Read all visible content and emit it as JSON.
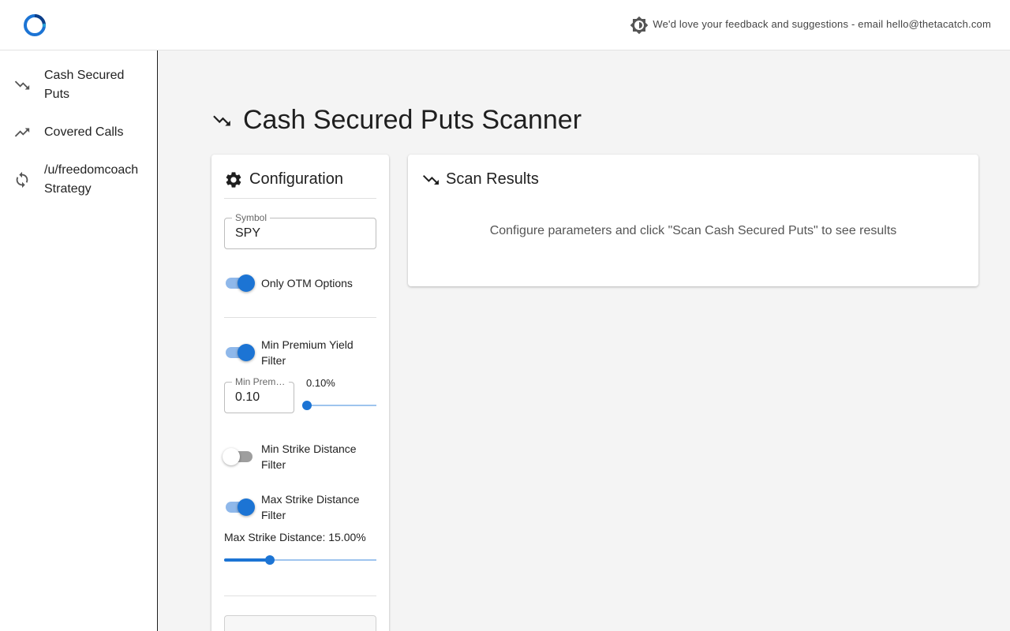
{
  "header": {
    "logo_icon": "ring-logo-icon",
    "theme_icon": "brightness-icon",
    "feedback_text": "We'd love your feedback and suggestions - email hello@thetacatch.com"
  },
  "sidebar": {
    "items": [
      {
        "icon": "trending-down-icon",
        "label": "Cash Secured Puts"
      },
      {
        "icon": "trending-up-icon",
        "label": "Covered Calls"
      },
      {
        "icon": "sync-icon",
        "label": "/u/freedomcoach Strategy"
      }
    ]
  },
  "page": {
    "title": "Cash Secured Puts Scanner",
    "title_icon": "trending-down-icon"
  },
  "config": {
    "title": "Configuration",
    "icon": "gear-icon",
    "symbol": {
      "label": "Symbol",
      "value": "SPY"
    },
    "otm": {
      "label": "Only OTM Options",
      "on": true
    },
    "min_premium": {
      "label": "Min Premium Yield Filter",
      "on": true,
      "input_label": "Min Premium Yield (%)",
      "input_value": "0.10",
      "slider_text": "0.10%",
      "slider_fraction": 0.0
    },
    "min_strike": {
      "label": "Min Strike Distance Filter",
      "on": false
    },
    "max_strike": {
      "label": "Max Strike Distance Filter",
      "on": true,
      "value_text": "Max Strike Distance: 15.00%",
      "slider_fraction": 0.3
    }
  },
  "results": {
    "title": "Scan Results",
    "icon": "trending-down-icon",
    "empty_message": "Configure parameters and click \"Scan Cash Secured Puts\" to see results"
  },
  "colors": {
    "accent": "#1c74d4",
    "accent_light": "#8fb8ea",
    "background": "#f4f4f4"
  }
}
